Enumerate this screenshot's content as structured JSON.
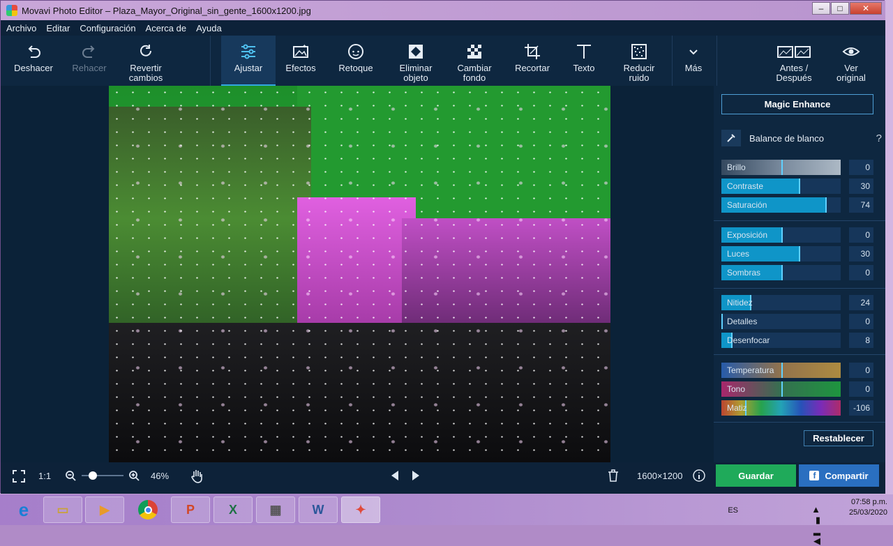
{
  "window": {
    "title": "Movavi Photo Editor – Plaza_Mayor_Original_sin_gente_1600x1200.jpg",
    "minimize": "–",
    "maximize": "□",
    "close": "✕"
  },
  "menu": [
    "Archivo",
    "Editar",
    "Configuración",
    "Acerca de",
    "Ayuda"
  ],
  "toolbar": {
    "undo": "Deshacer",
    "redo": "Rehacer",
    "revert": [
      "Revertir",
      "cambios"
    ],
    "adjust": "Ajustar",
    "effects": "Efectos",
    "retouch": "Retoque",
    "remove_object": [
      "Eliminar",
      "objeto"
    ],
    "change_bg": [
      "Cambiar",
      "fondo"
    ],
    "crop": "Recortar",
    "text": "Texto",
    "denoise": [
      "Reducir",
      "ruido"
    ],
    "more": "Más",
    "before_after": [
      "Antes /",
      "Después"
    ],
    "view_original": [
      "Ver",
      "original"
    ]
  },
  "panel": {
    "magic_enhance": "Magic Enhance",
    "white_balance": "Balance de blanco",
    "help": "?",
    "sliders": [
      {
        "label": "Brillo",
        "value": "0",
        "level": 0.5,
        "style": "gray"
      },
      {
        "label": "Contraste",
        "value": "30",
        "level": 0.65,
        "style": "blue"
      },
      {
        "label": "Saturación",
        "value": "74",
        "level": 0.87,
        "style": "blue"
      },
      {
        "label": "Exposición",
        "value": "0",
        "level": 0.5,
        "style": "blue"
      },
      {
        "label": "Luces",
        "value": "30",
        "level": 0.65,
        "style": "blue"
      },
      {
        "label": "Sombras",
        "value": "0",
        "level": 0.5,
        "style": "blue"
      },
      {
        "label": "Nitidez",
        "value": "24",
        "level": 0.24,
        "style": "blue"
      },
      {
        "label": "Detalles",
        "value": "0",
        "level": 0.0,
        "style": "blue"
      },
      {
        "label": "Desenfocar",
        "value": "8",
        "level": 0.08,
        "style": "blue"
      },
      {
        "label": "Temperatura",
        "value": "0",
        "level": 0.5,
        "style": "temp"
      },
      {
        "label": "Tono",
        "value": "0",
        "level": 0.5,
        "style": "tint"
      },
      {
        "label": "Matiz",
        "value": "-106",
        "level": 0.2,
        "style": "hue"
      }
    ],
    "reset": "Restablecer"
  },
  "bottom": {
    "ratio": "1:1",
    "zoom": "46%",
    "zoom_level": 0.2,
    "dimensions": "1600×1200",
    "save": "Guardar",
    "share": "Compartir"
  },
  "taskbar": {
    "lang": "ES",
    "time": "07:58 p.m.",
    "date": "25/03/2020"
  }
}
